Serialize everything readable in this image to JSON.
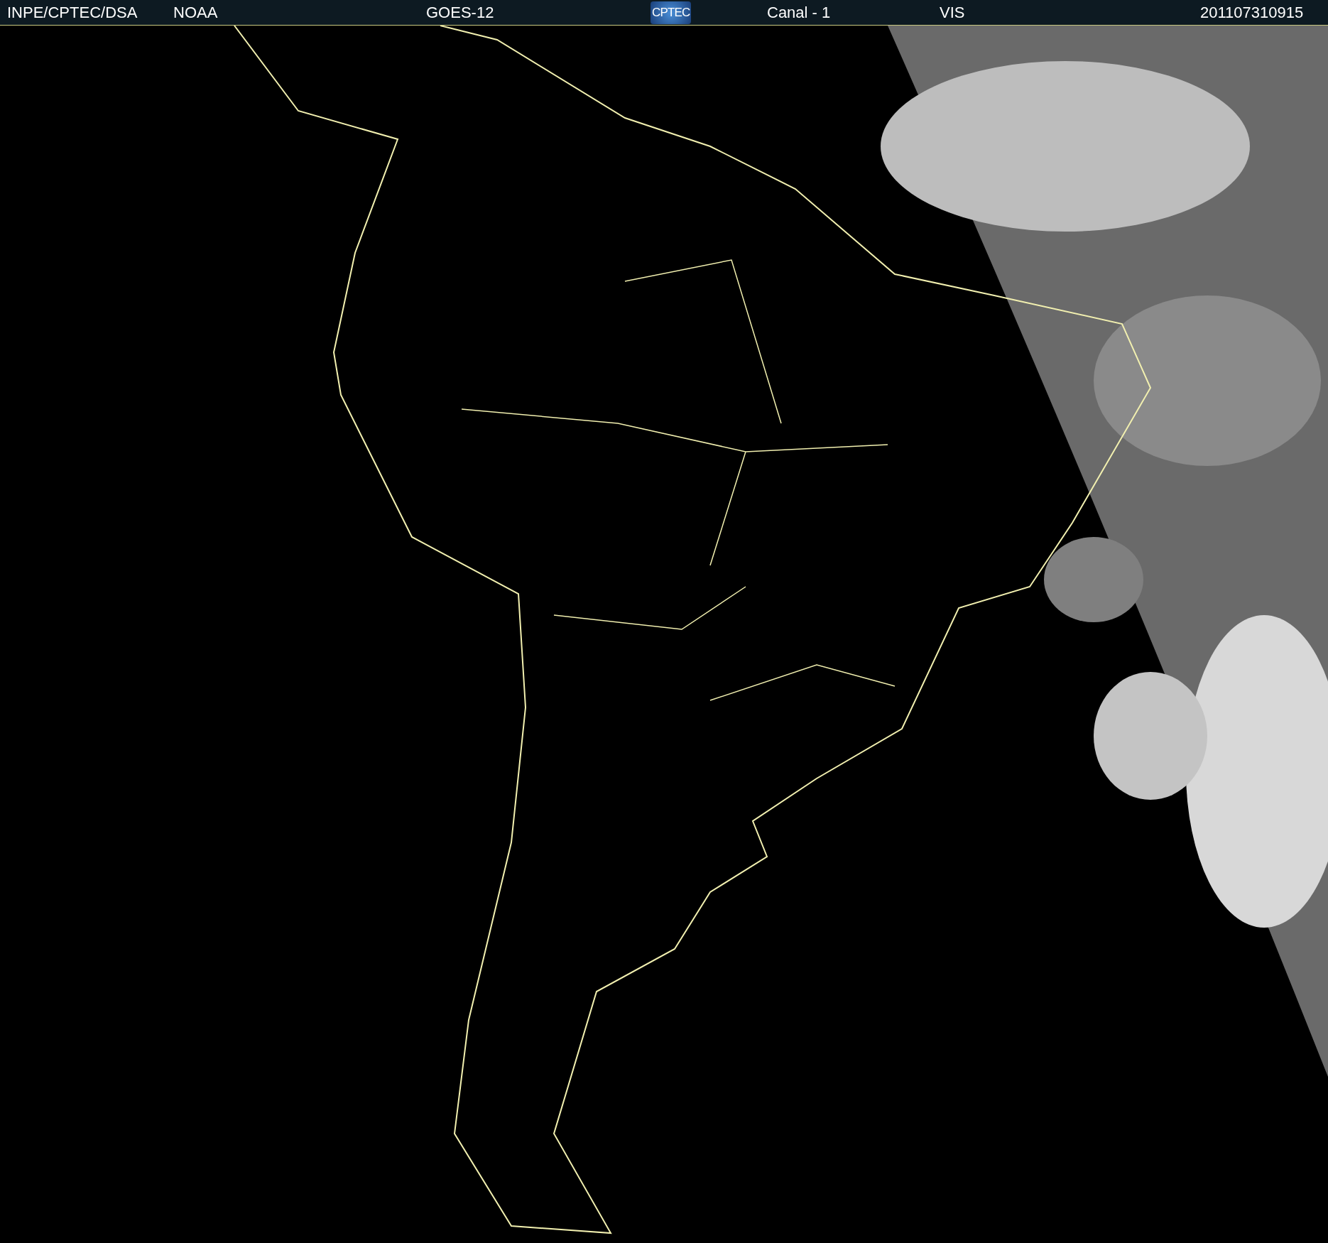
{
  "header": {
    "items": [
      {
        "kind": "text",
        "text": "INPE/CPTEC/DSA"
      },
      {
        "kind": "text",
        "text": "NOAA"
      },
      {
        "kind": "text",
        "text": "GOES-12"
      },
      {
        "kind": "logo",
        "text": "CPTEC"
      },
      {
        "kind": "text",
        "text": "Canal - 1"
      },
      {
        "kind": "text",
        "text": "VIS"
      },
      {
        "kind": "text",
        "text": "201107310915"
      }
    ]
  }
}
